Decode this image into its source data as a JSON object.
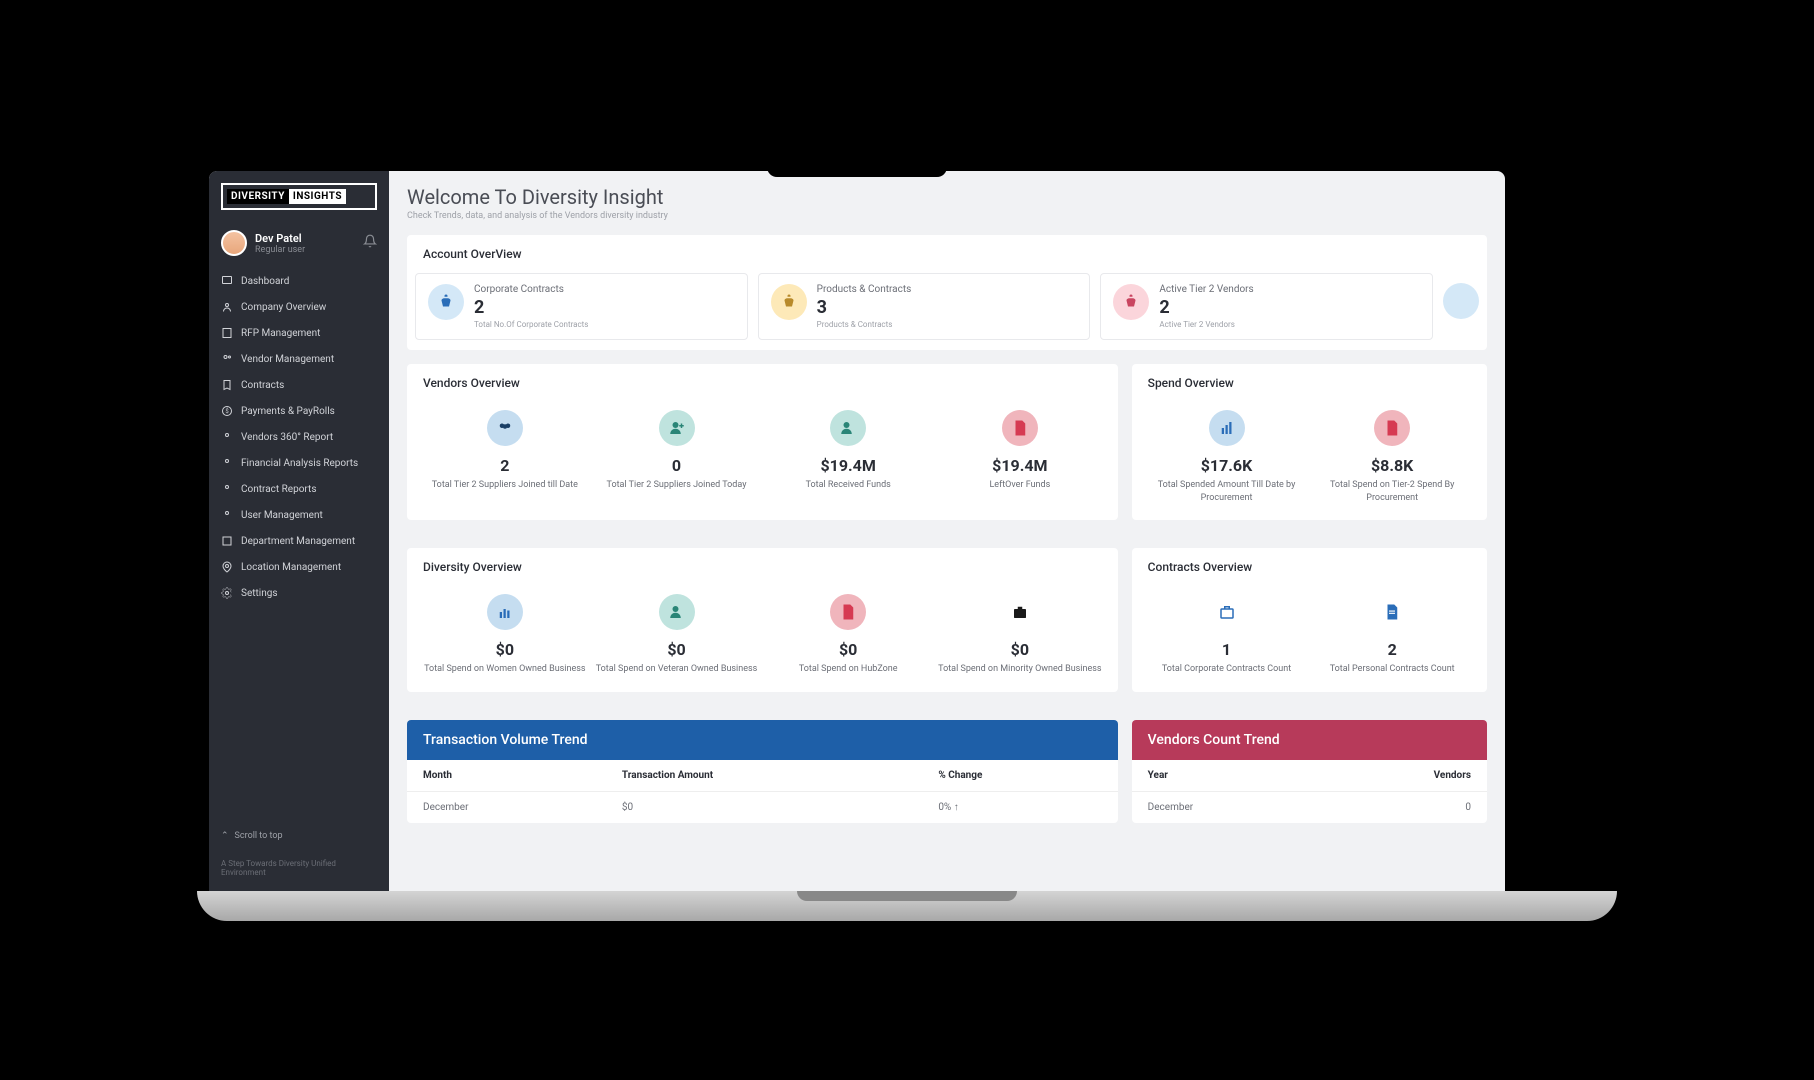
{
  "logo": {
    "left": "DIVERSITY",
    "right": "INSIGHTS"
  },
  "user": {
    "name": "Dev Patel",
    "role": "Regular user"
  },
  "nav": [
    {
      "label": "Dashboard"
    },
    {
      "label": "Company Overview"
    },
    {
      "label": "RFP Management"
    },
    {
      "label": "Vendor Management"
    },
    {
      "label": "Contracts"
    },
    {
      "label": "Payments & PayRolls"
    },
    {
      "label": "Vendors 360° Report"
    },
    {
      "label": "Financial Analysis Reports"
    },
    {
      "label": "Contract Reports"
    },
    {
      "label": "User Management"
    },
    {
      "label": "Department Management"
    },
    {
      "label": "Location Management"
    },
    {
      "label": "Settings"
    }
  ],
  "scroll_top": "Scroll to top",
  "footer": "A Step Towards Diversity Unified Environment",
  "page": {
    "title": "Welcome To Diversity Insight",
    "subtitle": "Check Trends, data, and analysis of the Vendors diversity industry"
  },
  "account": {
    "title": "Account OverView",
    "items": [
      {
        "label": "Corporate Contracts",
        "value": "2",
        "sub": "Total No.Of Corporate Contracts"
      },
      {
        "label": "Products & Contracts",
        "value": "3",
        "sub": "Products & Contracts"
      },
      {
        "label": "Active Tier 2 Vendors",
        "value": "2",
        "sub": "Active Tier 2 Vendors"
      }
    ]
  },
  "vendors": {
    "title": "Vendors Overview",
    "items": [
      {
        "value": "2",
        "label": "Total Tier 2 Suppliers Joined till Date"
      },
      {
        "value": "0",
        "label": "Total Tier 2 Suppliers Joined Today"
      },
      {
        "value": "$19.4M",
        "label": "Total Received Funds"
      },
      {
        "value": "$19.4M",
        "label": "LeftOver Funds"
      }
    ]
  },
  "spend": {
    "title": "Spend Overview",
    "items": [
      {
        "value": "$17.6K",
        "label": "Total Spended Amount Till Date by Procurement"
      },
      {
        "value": "$8.8K",
        "label": "Total Spend on Tier-2 Spend By Procurement"
      }
    ]
  },
  "diversity": {
    "title": "Diversity Overview",
    "items": [
      {
        "value": "$0",
        "label": "Total Spend on Women Owned Business"
      },
      {
        "value": "$0",
        "label": "Total Spend on Veteran Owned Business"
      },
      {
        "value": "$0",
        "label": "Total Spend on HubZone"
      },
      {
        "value": "$0",
        "label": "Total Spend on Minority Owned Business"
      }
    ]
  },
  "contracts": {
    "title": "Contracts Overview",
    "items": [
      {
        "value": "1",
        "label": "Total Corporate Contracts Count"
      },
      {
        "value": "2",
        "label": "Total Personal Contracts Count"
      }
    ]
  },
  "transaction_trend": {
    "title": "Transaction Volume Trend",
    "headers": [
      "Month",
      "Transaction Amount",
      "% Change"
    ],
    "rows": [
      {
        "month": "December",
        "amount": "$0",
        "change": "0% ↑"
      }
    ]
  },
  "vendors_trend": {
    "title": "Vendors Count Trend",
    "headers": [
      "Year",
      "Vendors"
    ],
    "rows": [
      {
        "year": "December",
        "vendors": "0"
      }
    ]
  }
}
